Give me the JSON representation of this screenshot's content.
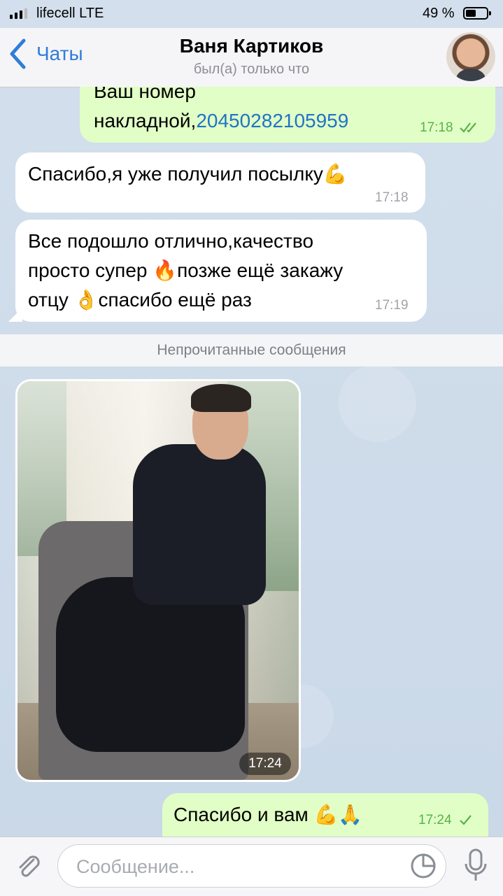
{
  "status_bar": {
    "carrier": "lifecell  LTE",
    "battery_percent": "49 %"
  },
  "header": {
    "back_label": "Чаты",
    "contact_name": "Ваня Картиков",
    "contact_status": "был(а) только что"
  },
  "messages": [
    {
      "direction": "out",
      "text_prefix": "Ваш номер накладной,",
      "link_text": "20450282105959",
      "time": "17:18",
      "read": true
    },
    {
      "direction": "in",
      "text": "Спасибо,я уже получил посылку💪",
      "time": "17:18"
    },
    {
      "direction": "in",
      "line1": "Все подошло отлично,качество",
      "line2": "просто супер 🔥позже ещё закажу",
      "line3": "отцу 👌спасибо ещё раз",
      "time": "17:19"
    },
    {
      "direction": "in",
      "type": "photo",
      "time": "17:24"
    },
    {
      "direction": "out",
      "text": "Спасибо и вам 💪🙏",
      "time": "17:24",
      "read": false
    }
  ],
  "unread_divider": "Непрочитанные сообщения",
  "composer": {
    "placeholder": "Сообщение..."
  },
  "colors": {
    "accent": "#2f7dd9",
    "outgoing_bubble": "#e1fec6",
    "incoming_bubble": "#ffffff",
    "read_check": "#58b24a",
    "link": "#1f74c7"
  },
  "icons": [
    "back-chevron-icon",
    "attachment-clip-icon",
    "sticker-icon",
    "microphone-icon",
    "double-check-icon",
    "single-check-icon"
  ]
}
